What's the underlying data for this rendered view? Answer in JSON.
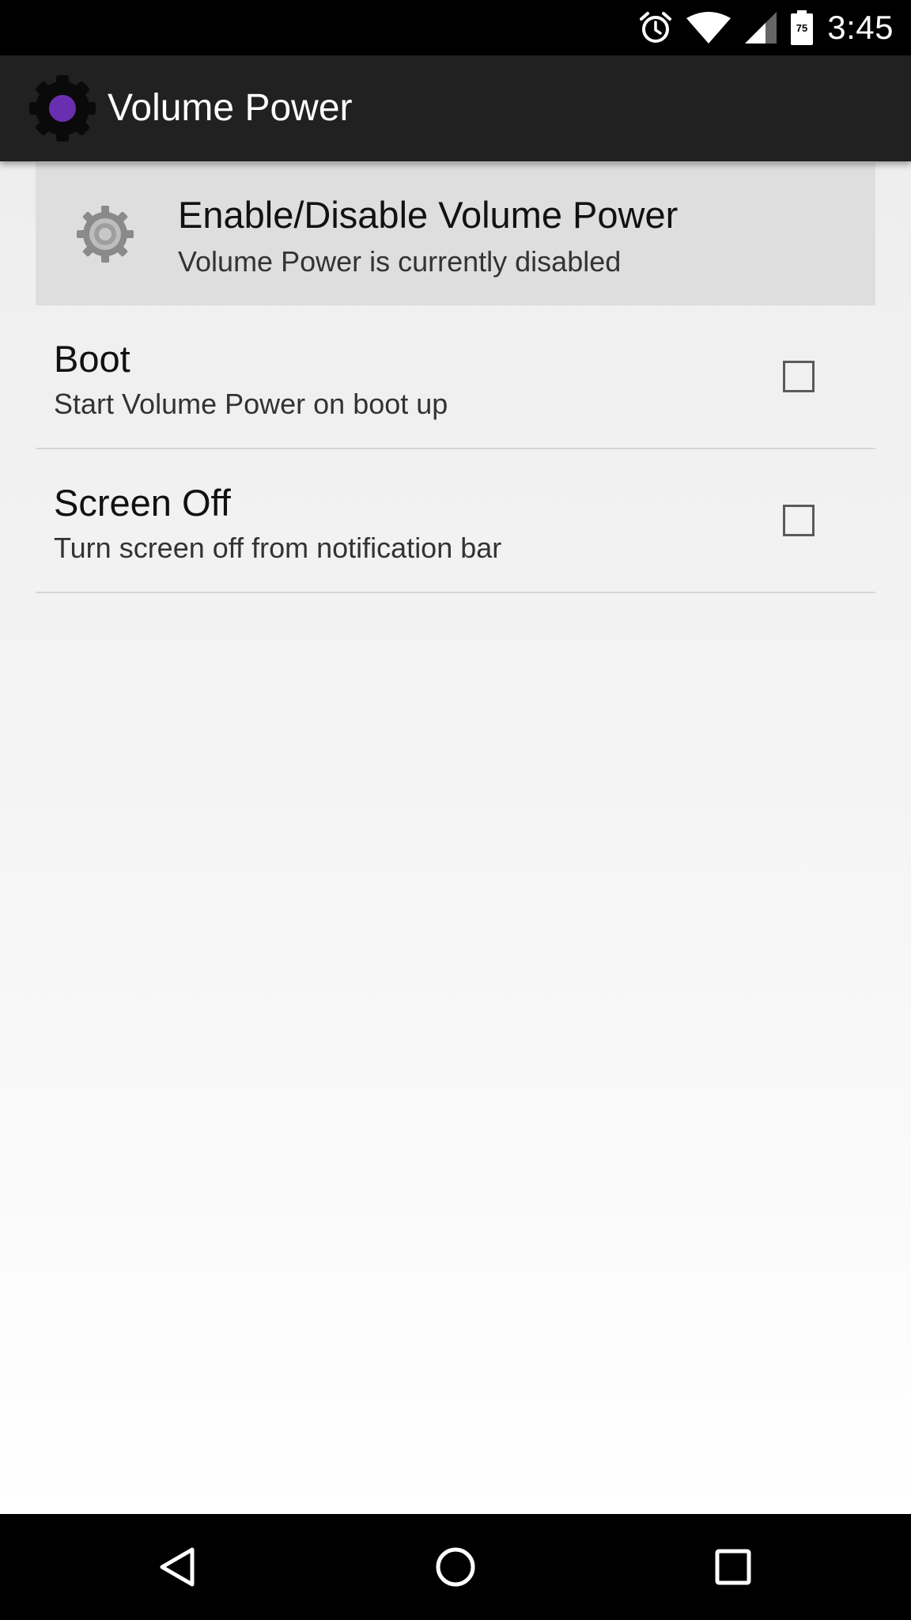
{
  "status_bar": {
    "time": "3:45",
    "battery_level": "75",
    "icons": [
      "alarm-icon",
      "wifi-icon",
      "cell-signal-icon",
      "battery-icon"
    ]
  },
  "app_bar": {
    "title": "Volume Power",
    "logo_icon": "volume-power-logo-icon",
    "accent_color": "#6a2fb0"
  },
  "preferences": {
    "enable": {
      "title": "Enable/Disable Volume Power",
      "summary": "Volume Power is currently disabled",
      "icon": "gear-icon"
    },
    "items": [
      {
        "title": "Boot",
        "summary": "Start Volume Power on boot up",
        "checked": false
      },
      {
        "title": "Screen Off",
        "summary": "Turn screen off from notification bar",
        "checked": false
      }
    ]
  },
  "nav_bar": {
    "buttons": [
      "back-icon",
      "home-icon",
      "recents-icon"
    ]
  }
}
